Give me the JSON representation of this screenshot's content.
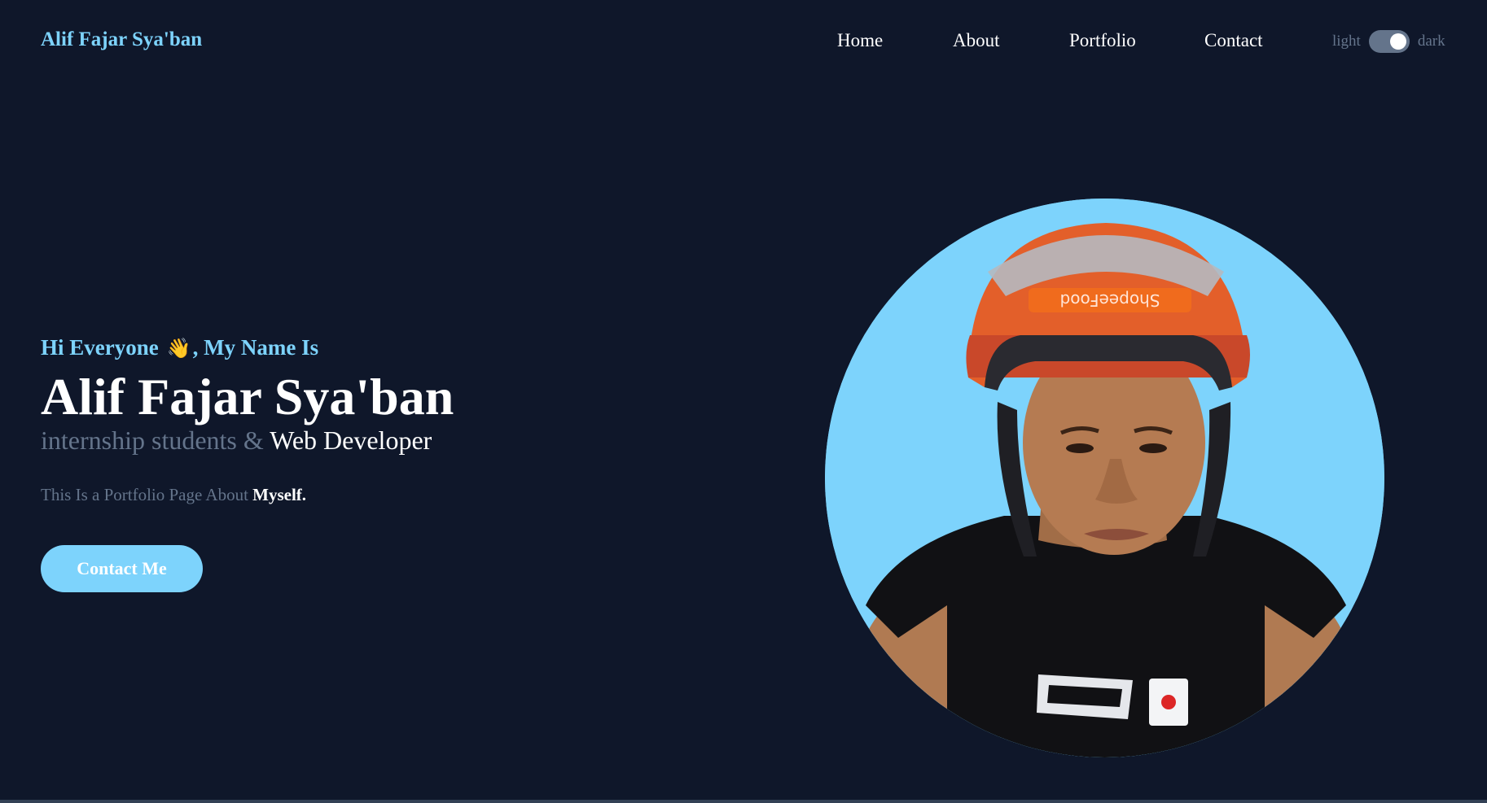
{
  "header": {
    "brand": "Alif Fajar Sya'ban",
    "nav": {
      "home": "Home",
      "about": "About",
      "portfolio": "Portfolio",
      "contact": "Contact"
    },
    "theme_toggle": {
      "light_label": "light",
      "dark_label": "dark",
      "state": "dark"
    }
  },
  "hero": {
    "greeting_prefix": "Hi Everyone",
    "greeting_emoji": "👋",
    "greeting_suffix": ", My Name Is",
    "name": "Alif Fajar Sya'ban",
    "role_prefix": "internship students &",
    "role_highlight": "Web Developer",
    "description_prefix": "This Is a Portfolio Page About",
    "description_bold": "Myself.",
    "cta_label": "Contact Me"
  },
  "profile_photo": {
    "icon": "profile-photo",
    "helmet_text": "ShopeeFood"
  },
  "colors": {
    "background": "#0f172a",
    "accent": "#7dd3fc",
    "muted": "#64748b",
    "text": "#ffffff"
  }
}
